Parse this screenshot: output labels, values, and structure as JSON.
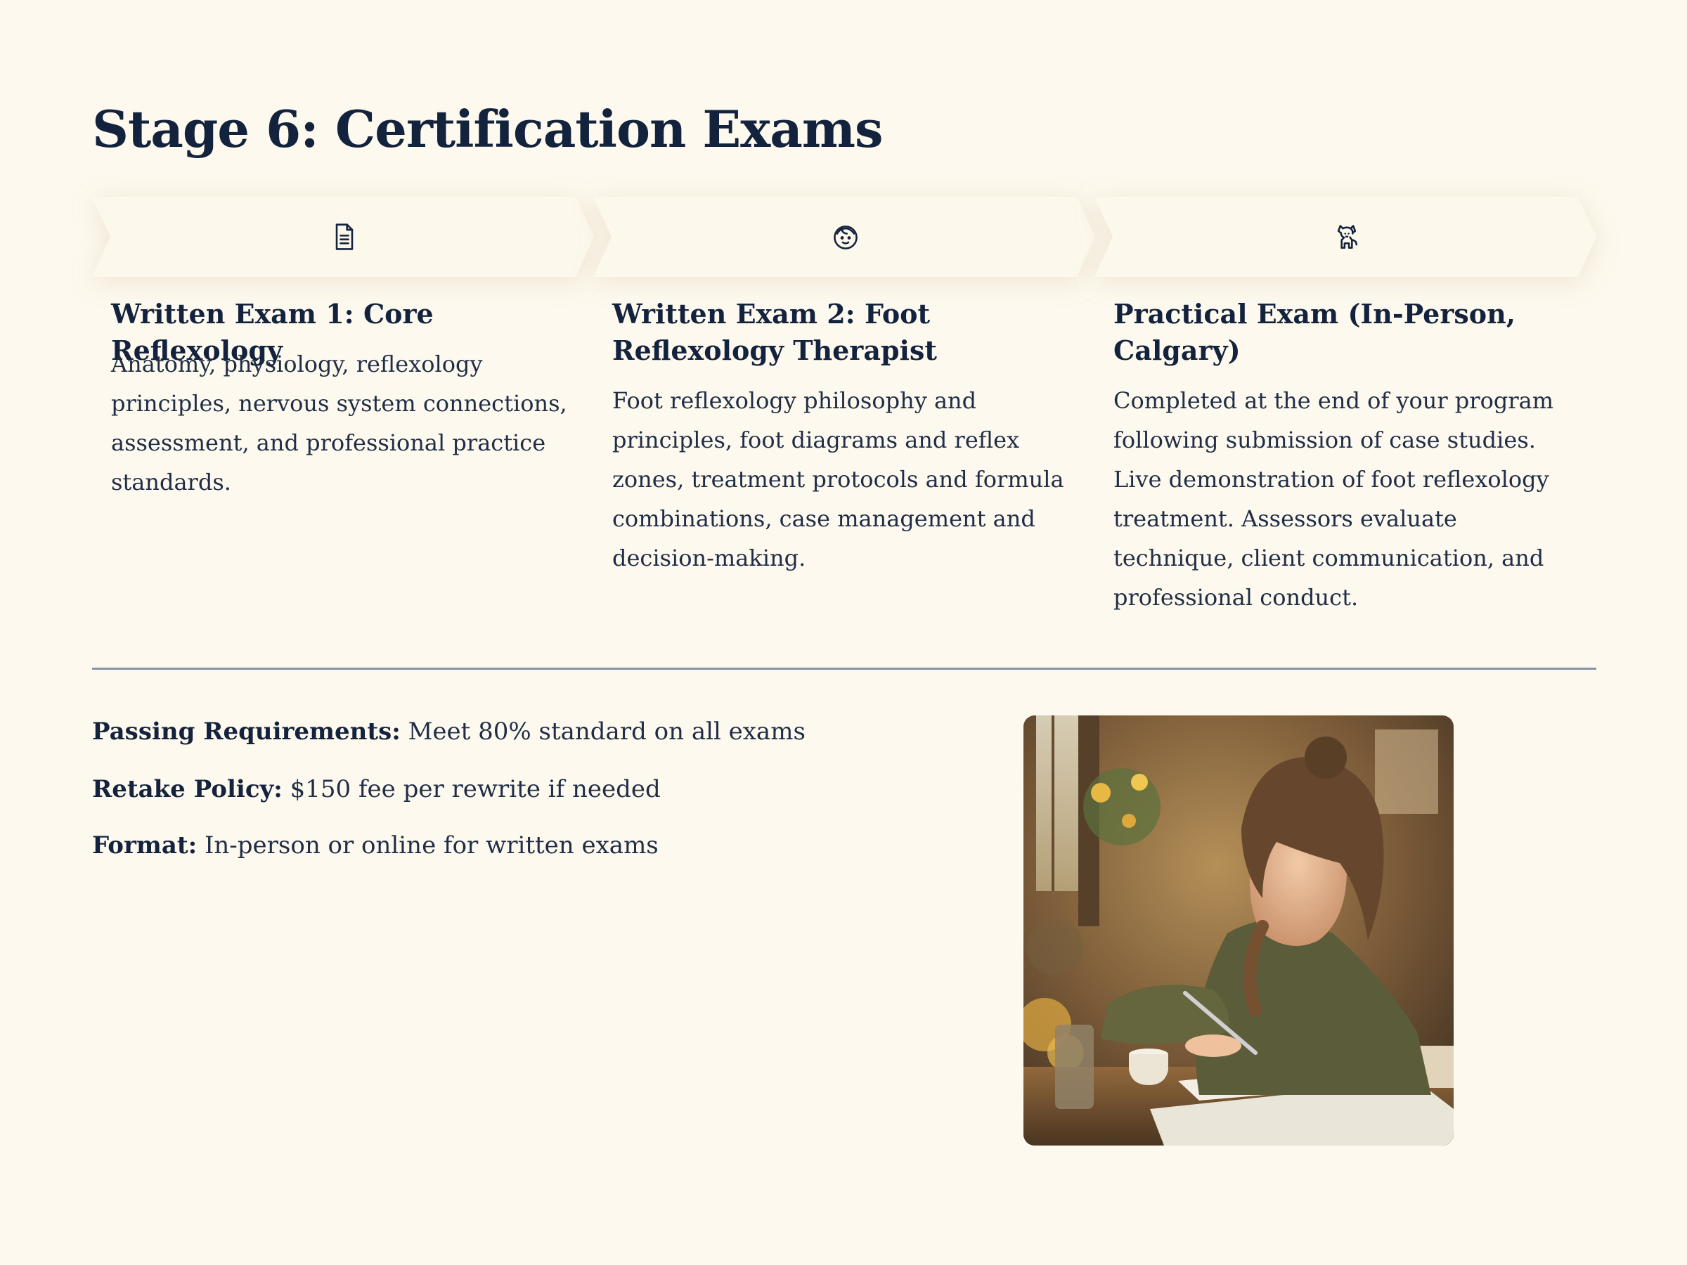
{
  "page": {
    "title": "Stage 6: Certification Exams"
  },
  "steps": [
    {
      "icon": "document-icon",
      "title": "Written Exam 1: Core Reflexology",
      "description": "Anatomy, physiology, reflexology principles, nervous system connections, assessment, and professional practice standards."
    },
    {
      "icon": "face-icon",
      "title": "Written Exam 2: Foot Reflexology Therapist",
      "description": "Foot reflexology philosophy and principles, foot diagrams and reflex zones, treatment protocols and formula combinations, case management and decision-making."
    },
    {
      "icon": "dog-icon",
      "title": "Practical Exam (In-Person, Calgary)",
      "description": "Completed at the end of your program following submission of case studies. Live demonstration of foot reflexology treatment. Assessors evaluate technique, client communication, and professional conduct."
    }
  ],
  "requirements": [
    {
      "label": "Passing Requirements:",
      "value": "Meet 80% standard on all exams"
    },
    {
      "label": "Retake Policy:",
      "value": "$150 fee per rewrite if needed"
    },
    {
      "label": "Format:",
      "value": "In-person or online for written exams"
    }
  ],
  "photo": {
    "subject": "woman-writing-at-desk"
  },
  "colors": {
    "background": "#fdf9ee",
    "text": "#14233d",
    "divider": "#8a93a5"
  }
}
